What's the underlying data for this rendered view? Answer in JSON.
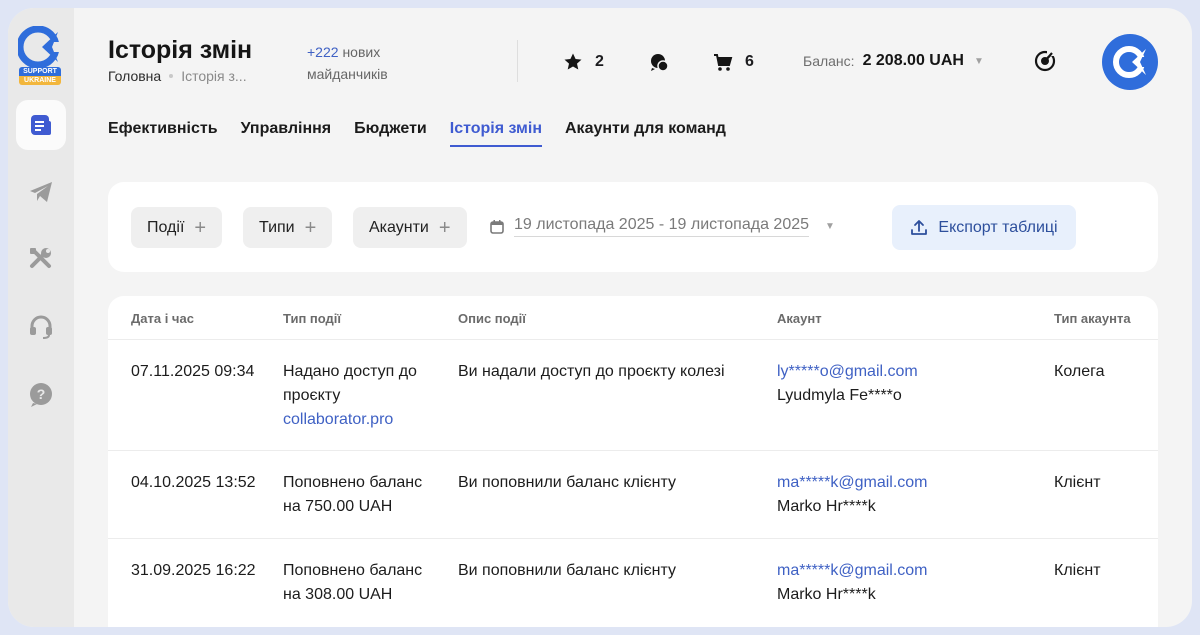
{
  "logo": {
    "badge_top": "SUPPORT",
    "badge_bottom": "UKRAINE"
  },
  "sidebar": {
    "items": [
      {
        "icon": "document-icon",
        "active": true
      },
      {
        "icon": "telegram-icon",
        "active": false
      },
      {
        "icon": "tools-icon",
        "active": false
      },
      {
        "icon": "headset-icon",
        "active": false
      },
      {
        "icon": "help-icon",
        "active": false
      }
    ]
  },
  "header": {
    "title": "Історія змін",
    "breadcrumb": {
      "home": "Головна",
      "current": "Історія з..."
    },
    "new_sites": {
      "count": "+222",
      "line1": "нових",
      "line2": "майданчиків"
    },
    "favorites_count": "2",
    "cart_count": "6",
    "balance_label": "Баланс:",
    "balance_value": "2 208.00 UAH"
  },
  "tabs": [
    {
      "label": "Ефективність",
      "active": false
    },
    {
      "label": "Управління",
      "active": false
    },
    {
      "label": "Бюджети",
      "active": false
    },
    {
      "label": "Історія змін",
      "active": true
    },
    {
      "label": "Акаунти для команд",
      "active": false
    }
  ],
  "filters": {
    "events": "Події",
    "types": "Типи",
    "accounts": "Акаунти",
    "date_range": "19 листопада 2025 - 19 листопада 2025",
    "export": "Експорт таблиці"
  },
  "table": {
    "columns": [
      "Дата і час",
      "Тип події",
      "Опис події",
      "Акаунт",
      "Тип акаунта"
    ],
    "rows": [
      {
        "datetime": "07.11.2025 09:34",
        "type_line1": "Надано доступ до",
        "type_line2": "проєкту",
        "type_link": "collaborator.pro",
        "description": "Ви надали доступ до проєкту колезі",
        "email": "ly*****o@gmail.com",
        "name": "Lyudmyla Fe****o",
        "account_type": "Колега"
      },
      {
        "datetime": "04.10.2025 13:52",
        "type_line1": "Поповнено баланс",
        "type_line2": "на 750.00 UAH",
        "type_link": "",
        "description": "Ви поповнили баланс клієнту",
        "email": "ma*****k@gmail.com",
        "name": "Marko Hr****k",
        "account_type": "Клієнт"
      },
      {
        "datetime": "31.09.2025 16:22",
        "type_line1": "Поповнено баланс",
        "type_line2": "на 308.00 UAH",
        "type_link": "",
        "description": "Ви поповнили баланс клієнту",
        "email": "ma*****k@gmail.com",
        "name": "Marko Hr****k",
        "account_type": "Клієнт"
      }
    ]
  },
  "colors": {
    "accent": "#3f5bd1",
    "link": "#3f61c4",
    "brand": "#2f6ddb"
  }
}
